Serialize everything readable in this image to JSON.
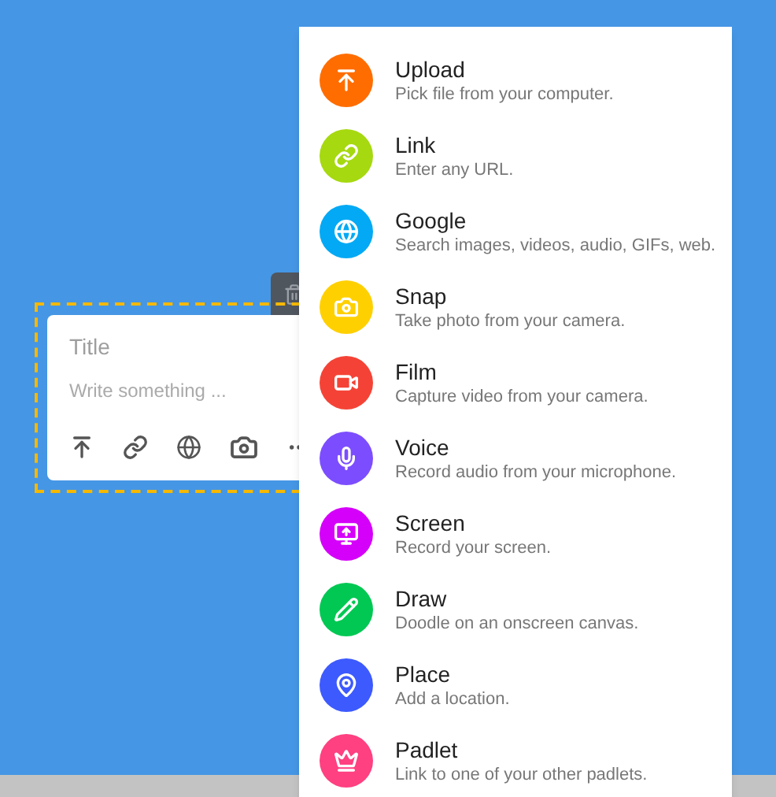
{
  "card": {
    "title_placeholder": "Title",
    "body_placeholder": "Write something ..."
  },
  "menu": [
    {
      "kind": "upload",
      "title": "Upload",
      "description": "Pick file from your computer.",
      "color": "#ff6d00"
    },
    {
      "kind": "link",
      "title": "Link",
      "description": "Enter any URL.",
      "color": "#a6d910"
    },
    {
      "kind": "search",
      "title": "Google",
      "description": "Search images, videos, audio, GIFs, web.",
      "color": "#03a9f4"
    },
    {
      "kind": "camera",
      "title": "Snap",
      "description": "Take photo from your camera.",
      "color": "#ffd000"
    },
    {
      "kind": "video",
      "title": "Film",
      "description": "Capture video from your camera.",
      "color": "#f44336"
    },
    {
      "kind": "mic",
      "title": "Voice",
      "description": "Record audio from your microphone.",
      "color": "#7c4dff"
    },
    {
      "kind": "screen",
      "title": "Screen",
      "description": "Record your screen.",
      "color": "#d500f9"
    },
    {
      "kind": "draw",
      "title": "Draw",
      "description": "Doodle on an onscreen canvas.",
      "color": "#00c853"
    },
    {
      "kind": "place",
      "title": "Place",
      "description": "Add a location.",
      "color": "#3d5afe"
    },
    {
      "kind": "padlet",
      "title": "Padlet",
      "description": "Link to one of your other padlets.",
      "color": "#ff4081"
    }
  ]
}
